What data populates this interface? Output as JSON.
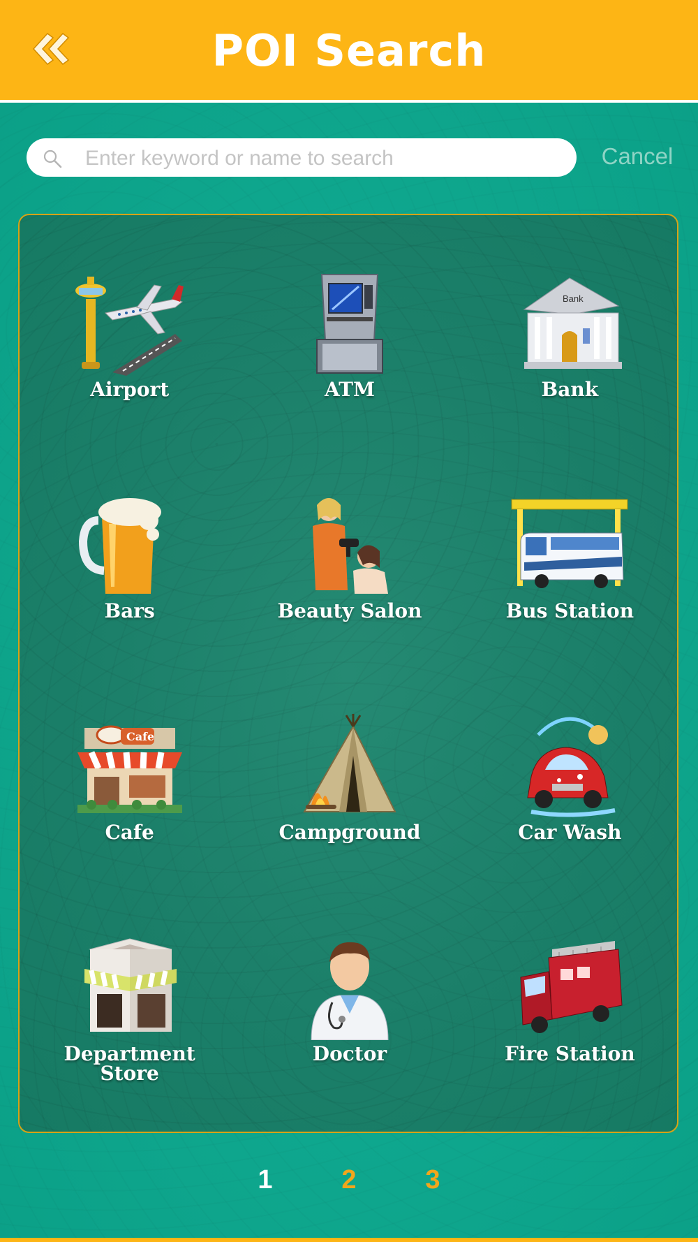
{
  "header": {
    "title": "POI Search",
    "back_icon": "double-chevron-left-icon"
  },
  "search": {
    "placeholder": "Enter keyword or name to search",
    "value": "",
    "cancel_label": "Cancel"
  },
  "categories": [
    {
      "label": "Airport",
      "icon": "airport-icon"
    },
    {
      "label": "ATM",
      "icon": "atm-icon"
    },
    {
      "label": "Bank",
      "icon": "bank-icon"
    },
    {
      "label": "Bars",
      "icon": "beer-mug-icon"
    },
    {
      "label": "Beauty Salon",
      "icon": "beauty-salon-icon"
    },
    {
      "label": "Bus Station",
      "icon": "bus-station-icon"
    },
    {
      "label": "Cafe",
      "icon": "cafe-icon"
    },
    {
      "label": "Campground",
      "icon": "tent-icon"
    },
    {
      "label": "Car Wash",
      "icon": "car-wash-icon"
    },
    {
      "label": "Department\nStore",
      "icon": "store-icon"
    },
    {
      "label": "Doctor",
      "icon": "doctor-icon"
    },
    {
      "label": "Fire Station",
      "icon": "fire-truck-icon"
    }
  ],
  "bank_sign": "Bank",
  "cafe_sign": "Cafe",
  "pagination": {
    "pages": [
      "1",
      "2",
      "3"
    ],
    "current": "1"
  },
  "colors": {
    "header": "#fdb515",
    "background": "#0fa88f",
    "panel": "#1b7f69",
    "active_page": "#ffffff",
    "inactive_page": "#f2a61c"
  }
}
